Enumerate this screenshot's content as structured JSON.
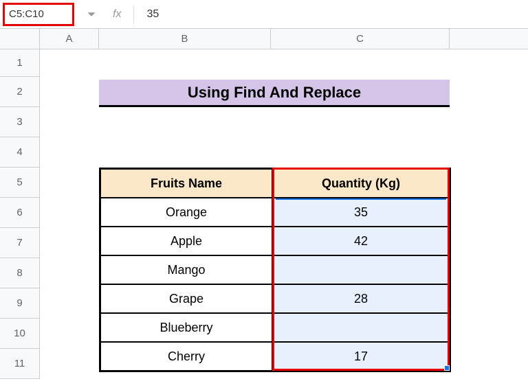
{
  "formula_bar": {
    "name_box": "C5:C10",
    "fx_label": "fx",
    "value": "35"
  },
  "columns": {
    "a": "A",
    "b": "B",
    "c": "C"
  },
  "rows": {
    "r1": "1",
    "r2": "2",
    "r3": "3",
    "r4": "4",
    "r5": "5",
    "r6": "6",
    "r7": "7",
    "r8": "8",
    "r9": "9",
    "r10": "10",
    "r11": "11"
  },
  "title": "Using Find And Replace",
  "table": {
    "headers": {
      "fruits": "Fruits Name",
      "qty": "Quantity (Kg)"
    },
    "rows": [
      {
        "fruit": "Orange",
        "qty": "35"
      },
      {
        "fruit": "Apple",
        "qty": "42"
      },
      {
        "fruit": "Mango",
        "qty": ""
      },
      {
        "fruit": "Grape",
        "qty": "28"
      },
      {
        "fruit": "Blueberry",
        "qty": ""
      },
      {
        "fruit": "Cherry",
        "qty": "17"
      }
    ]
  }
}
